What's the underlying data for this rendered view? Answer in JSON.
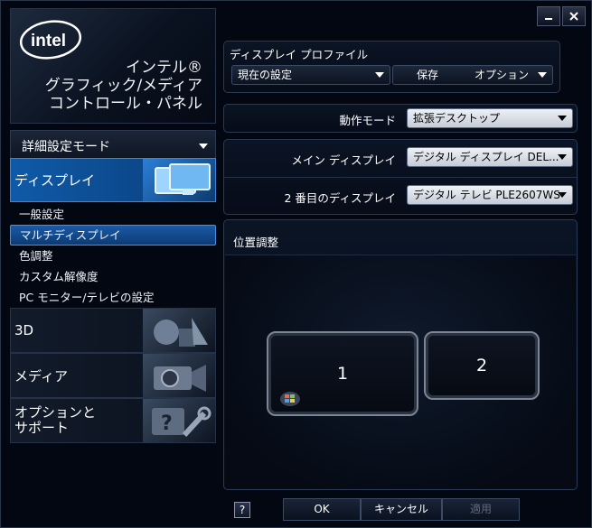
{
  "window": {
    "minimize_icon": "minimize-icon",
    "close_icon": "close-icon"
  },
  "brand": {
    "logo_text": "intel",
    "title_lines": [
      "インテル®",
      "グラフィック/メディア",
      "コントロール・パネル"
    ]
  },
  "mode_selector": {
    "label": "詳細設定モード"
  },
  "categories": {
    "display": "ディスプレイ",
    "three_d": "3D",
    "media": "メディア",
    "options_lines": [
      "オプションと",
      "サポート"
    ]
  },
  "display_subitems": [
    "一般設定",
    "マルチディスプレイ",
    "色調整",
    "カスタム解像度",
    "PC モニター/テレビの設定"
  ],
  "active_subitem": "マルチディスプレイ",
  "profile": {
    "title": "ディスプレイ プロファイル",
    "current": "現在の設定",
    "save": "保存",
    "options": "オプション"
  },
  "operation_mode": {
    "label": "動作モード",
    "value": "拡張デスクトップ"
  },
  "main_display": {
    "label": "メイン ディスプレイ",
    "value": "デジタル ディスプレイ DEL..."
  },
  "second_display": {
    "label": "2 番目のディスプレイ",
    "value": "デジタル テレビ PLE2607WS"
  },
  "positioning": {
    "title": "位置調整",
    "monitor1": "1",
    "monitor2": "2"
  },
  "buttons": {
    "help": "?",
    "ok": "OK",
    "cancel": "キャンセル",
    "apply": "適用"
  }
}
